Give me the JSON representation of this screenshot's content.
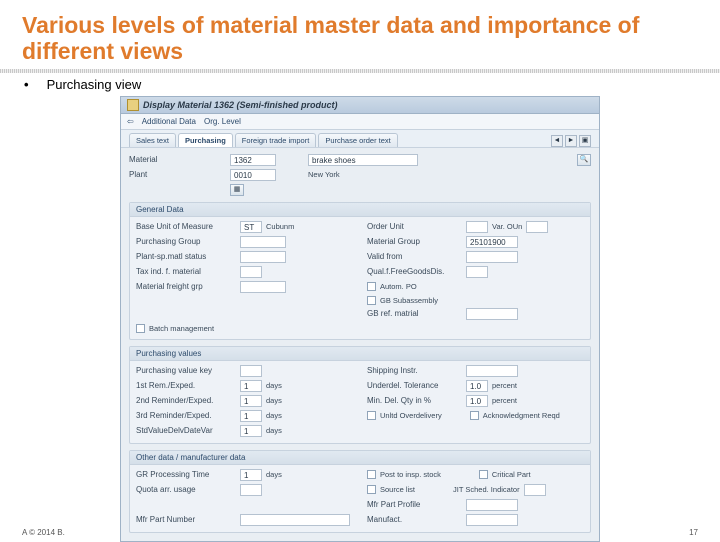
{
  "slide": {
    "title": "Various levels of material master data and importance of different views",
    "bullet": "Purchasing view",
    "copyright": "A © 2014 B.",
    "page": "17"
  },
  "sap": {
    "window_title": "Display Material 1362 (Semi-finished product)",
    "toolbar": {
      "arrow": "⇦",
      "btn1": "Additional Data",
      "btn2": "Org. Level"
    },
    "tabs": {
      "t1": "Sales text",
      "t2": "Purchasing",
      "t3": "Foreign trade import",
      "t4": "Purchase order text",
      "nav_l": "◄",
      "nav_r": "►",
      "nav_end": "▣"
    },
    "head": {
      "material_lbl": "Material",
      "material_val": "1362",
      "desc": "brake shoes",
      "plant_lbl": "Plant",
      "plant_val": "0010",
      "plant_name": "New York",
      "search": "🔍"
    },
    "general": {
      "hdr": "General Data",
      "uom_lbl": "Base Unit of Measure",
      "uom_val": "ST",
      "uom_txt": "Cubunm",
      "order_unit_lbl": "Order Unit",
      "var_lbl": "Var. OUn",
      "pgroup_lbl": "Purchasing Group",
      "matgrp_lbl": "Material Group",
      "matgrp_val": "25101900",
      "pms_lbl": "Plant-sp.matl status",
      "valid_lbl": "Valid from",
      "tax_lbl": "Tax ind. f. material",
      "qfg_lbl": "Qual.f.FreeGoodsDis.",
      "mfr_lbl": "Material freight grp",
      "autopo_lbl": "Autom. PO",
      "gbsub_lbl": "GB Subassembly",
      "gbref_lbl": "GB ref. matrial",
      "batch_lbl": "Batch management"
    },
    "pvalues": {
      "hdr": "Purchasing values",
      "pvkey_lbl": "Purchasing value key",
      "ship_lbl": "Shipping Instr.",
      "rem1_lbl": "1st Rem./Exped.",
      "rem1_v": "1",
      "rem2_lbl": "2nd Reminder/Exped.",
      "rem2_v": "1",
      "rem3_lbl": "3rd Reminder/Exped.",
      "rem3_v": "1",
      "std_lbl": "StdValueDelvDateVar",
      "std_v": "1",
      "days": "days",
      "udtol_lbl": "Underdel. Tolerance",
      "udtol_v": "1.0",
      "mindel_lbl": "Min. Del. Qty in %",
      "mindel_v": "1.0",
      "unlover_lbl": "Unltd Overdelivery",
      "ack_lbl": "Acknowledgment Reqd",
      "pct": "percent"
    },
    "other": {
      "hdr": "Other data / manufacturer data",
      "gr_lbl": "GR Processing Time",
      "gr_v": "1",
      "days": "days",
      "quota_lbl": "Quota arr. usage",
      "post_lbl": "Post to insp. stock",
      "src_lbl": "Source list",
      "crit_lbl": "Critical Part",
      "jit_lbl": "JIT Sched. Indicator",
      "mfrpart_lbl": "Mfr Part Number",
      "mfrprof_lbl": "Mfr Part Profile",
      "manuf_lbl": "Manufact."
    }
  }
}
